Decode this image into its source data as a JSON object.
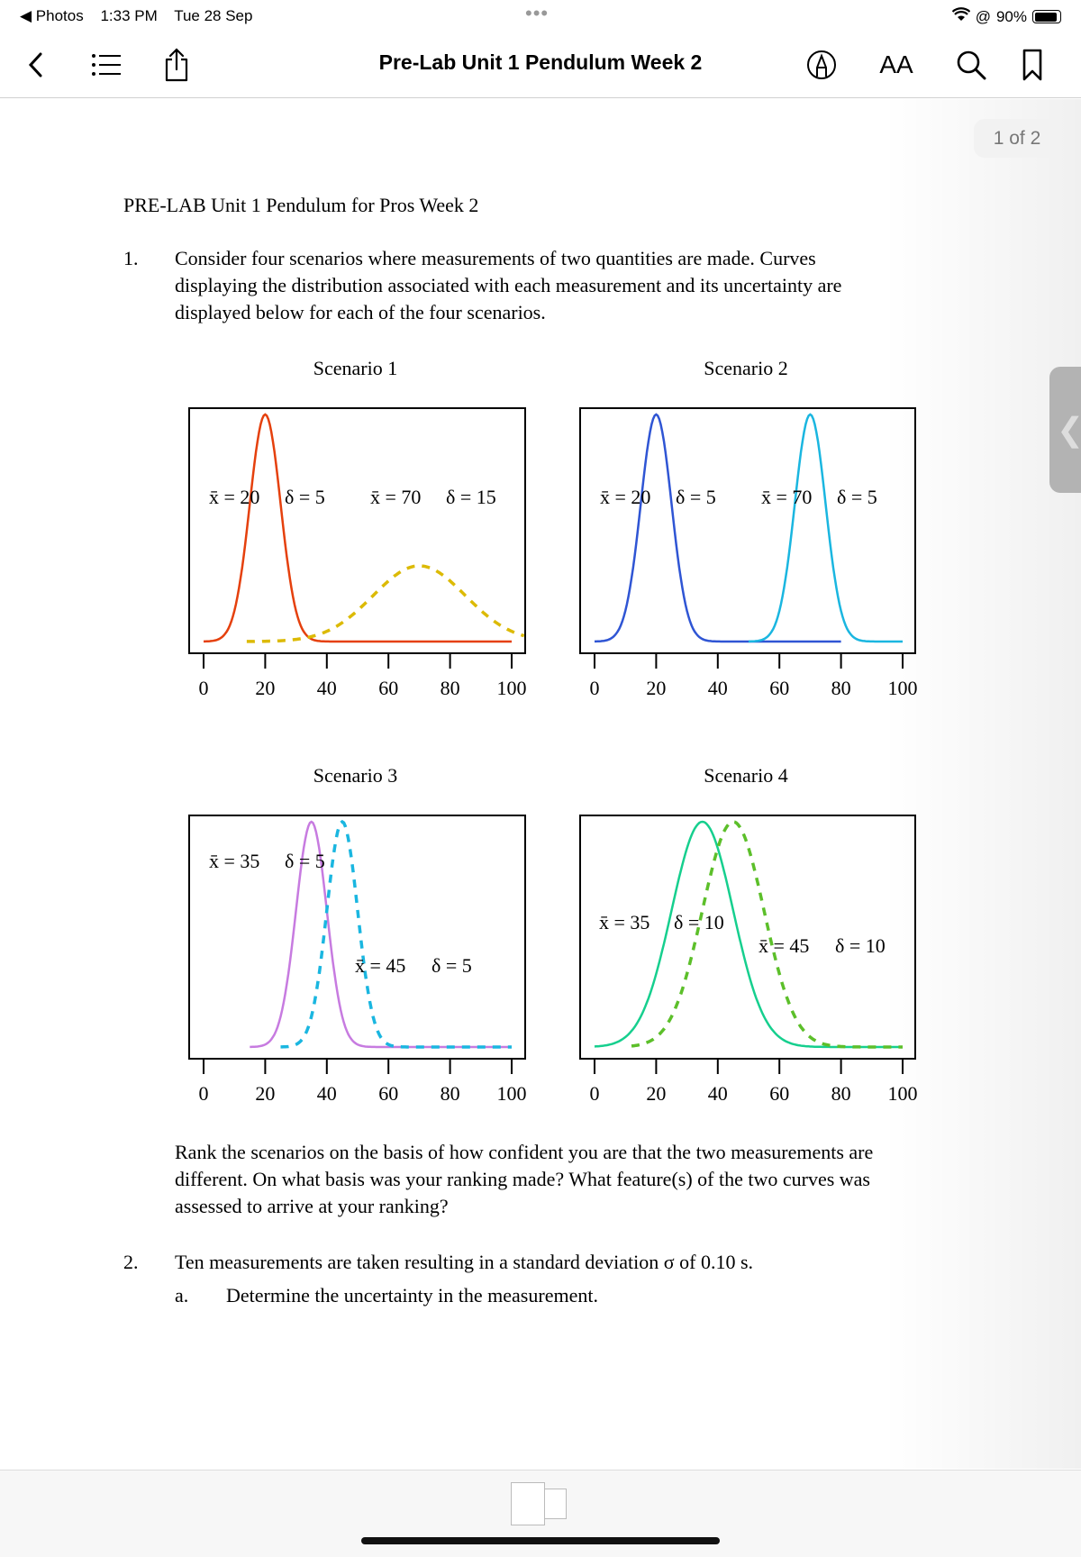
{
  "status_bar": {
    "back_app": "Photos",
    "time": "1:33 PM",
    "date": "Tue 28 Sep",
    "battery": "90%",
    "battery_level": 0.9
  },
  "toolbar": {
    "title": "Pre-Lab Unit 1 Pendulum Week 2",
    "icons": [
      "back-chevron-icon",
      "list-icon",
      "share-icon",
      "markup-icon",
      "text-size-icon",
      "search-icon",
      "bookmark-icon"
    ],
    "text_size_label": "AA"
  },
  "page_indicator": "1 of 2",
  "document": {
    "heading": "PRE-LAB Unit 1 Pendulum for Pros Week 2",
    "q1_number": "1.",
    "q1_lines": [
      "Consider four scenarios where measurements of two quantities are made. Curves",
      "displaying the distribution associated with each measurement and its uncertainty are",
      "displayed below for each of the four scenarios."
    ],
    "q1_followup": [
      "Rank the scenarios on the basis of how confident you are that the two measurements are",
      "different. On what basis was your ranking made? What feature(s) of the two curves was",
      "assessed to arrive at your ranking?"
    ],
    "q2_number": "2.",
    "q2_text": "Ten measurements are taken resulting in a standard deviation σ of 0.10 s.",
    "q2a_letter": "a.",
    "q2a_text": "Determine the uncertainty in the measurement."
  },
  "chart_data": [
    {
      "type": "line",
      "title": "Scenario 1",
      "x_ticks": [
        "0",
        "20",
        "40",
        "60",
        "80",
        "100"
      ],
      "xlim": [
        0,
        100
      ],
      "annotations": [
        "x̄ = 20",
        "δ = 5",
        "x̄ = 70",
        "δ = 15"
      ],
      "series": [
        {
          "mean": 20,
          "delta": 5,
          "style": "solid",
          "color": "#e5400d",
          "x_range": [
            0,
            100
          ]
        },
        {
          "mean": 70,
          "delta": 15,
          "style": "dashed",
          "color": "#dcba05",
          "x_range": [
            14,
            104
          ]
        }
      ]
    },
    {
      "type": "line",
      "title": "Scenario 2",
      "x_ticks": [
        "0",
        "20",
        "40",
        "60",
        "80",
        "100"
      ],
      "xlim": [
        0,
        100
      ],
      "annotations": [
        "x̄ = 20",
        "δ = 5",
        "x̄ = 70",
        "δ = 5"
      ],
      "series": [
        {
          "mean": 20,
          "delta": 5,
          "style": "solid",
          "color": "#2f55d4",
          "x_range": [
            0,
            80
          ]
        },
        {
          "mean": 70,
          "delta": 5,
          "style": "solid",
          "color": "#1ab6e0",
          "x_range": [
            50,
            100
          ]
        }
      ]
    },
    {
      "type": "line",
      "title": "Scenario 3",
      "x_ticks": [
        "0",
        "20",
        "40",
        "60",
        "80",
        "100"
      ],
      "xlim": [
        0,
        100
      ],
      "annotations": [
        "x̄ = 35",
        "δ = 5",
        "x̄ = 45",
        "δ = 5"
      ],
      "series": [
        {
          "mean": 35,
          "delta": 5,
          "style": "solid",
          "color": "#c77be0",
          "x_range": [
            15,
            100
          ]
        },
        {
          "mean": 45,
          "delta": 5,
          "style": "dashed",
          "color": "#1ab6e0",
          "x_range": [
            25,
            100
          ]
        }
      ]
    },
    {
      "type": "line",
      "title": "Scenario 4",
      "x_ticks": [
        "0",
        "20",
        "40",
        "60",
        "80",
        "100"
      ],
      "xlim": [
        0,
        100
      ],
      "annotations": [
        "x̄ = 35",
        "δ = 10",
        "x̄ = 45",
        "δ = 10"
      ],
      "series": [
        {
          "mean": 35,
          "delta": 10,
          "style": "solid",
          "color": "#16cf8e",
          "x_range": [
            0,
            100
          ]
        },
        {
          "mean": 45,
          "delta": 10,
          "style": "dashed",
          "color": "#5cbf2a",
          "x_range": [
            12,
            100
          ]
        }
      ]
    }
  ]
}
